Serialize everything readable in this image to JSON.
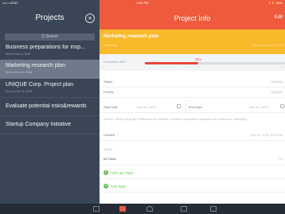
{
  "status_bar": {
    "carrier": "•••○○ AT&T",
    "time": "2:40 PM",
    "battery": "1 ⚡ 89%"
  },
  "sidebar": {
    "title": "Projects",
    "add_icon": "plus-circle-icon",
    "search_placeholder": "Q Search",
    "projects": [
      {
        "name": "Business preparations for insp...",
        "due": "Due on Nov 6, 2015"
      },
      {
        "name": "Marketing research plan",
        "due": "Due on Dec 10, 2015"
      },
      {
        "name": "UNIQUE Corp. Project plan",
        "due": "Due on Dec 14, 2015"
      },
      {
        "name": "Evaluate potential risks&rewards",
        "due": ""
      },
      {
        "name": "Startup Company Initiative",
        "due": ""
      }
    ]
  },
  "header": {
    "title": "Project Info",
    "edit_label": "Edit"
  },
  "banner": {
    "project_name": "Marketing research plan",
    "workspace": "Marketing",
    "due": "Due on Dec 10, 2015"
  },
  "progress": {
    "label": "Completed 8/21",
    "percent_label": "38%",
    "value": 0.38
  },
  "fields": {
    "status_label": "Status",
    "status_value": "Pending",
    "priority_label": "Priority",
    "priority_value": "Medium",
    "start_label": "Start Date",
    "start_value": "Sep 08, 2015",
    "end_label": "End Date",
    "end_value": "Dec 10, 2015",
    "description": "Search: Ready to grow? Research the market, conduct competitive analysis and review our marketing",
    "created_label": "Created",
    "created_value": "Apr 11, 2015, 6:57 PM"
  },
  "activity": {
    "label": "Activity",
    "all_tasks_label": "All Tasks",
    "all_tasks_count": "13",
    "add_new_task": "Add new Task",
    "add_task": "Add Task"
  },
  "tabbar": {
    "tabs": [
      "home-icon",
      "projects-icon",
      "people-icon",
      "trash-icon",
      "notes-icon"
    ],
    "active": 1
  },
  "colors": {
    "accent": "#ef5a3c",
    "banner": "#f8b92a",
    "sidebar": "#3a4656",
    "add_green": "#5cc24d"
  }
}
